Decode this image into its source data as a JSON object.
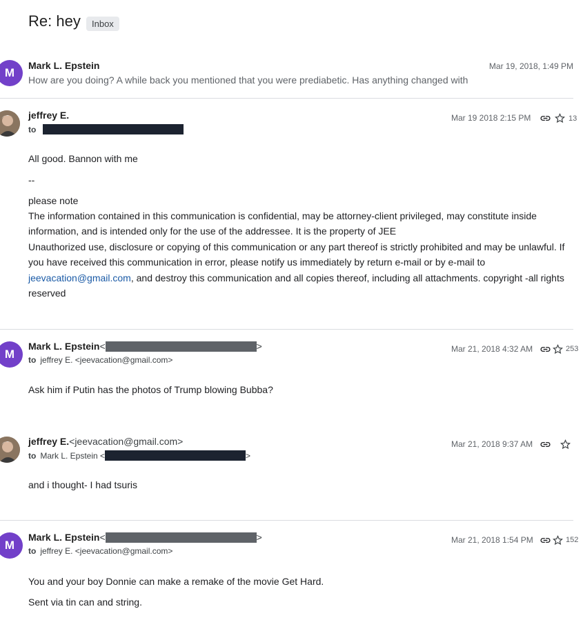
{
  "thread": {
    "subject": "Re: hey",
    "label": "Inbox"
  },
  "messages": [
    {
      "avatar_letter": "M",
      "sender": "Mark L. Epstein",
      "date": "Mar 19, 2018, 1:49 PM",
      "snippet": "How are you doing? A while back you mentioned that you were prediabetic. Has anything changed with"
    },
    {
      "sender": "jeffrey E.",
      "to_label": "to",
      "date": "Mar 19 2018 2:15 PM",
      "count": "13",
      "body_line1": "All good. Bannon with me",
      "sig_sep": "--",
      "sig_note": "please note",
      "sig_p1": "The information contained in this communication is confidential, may be attorney-client privileged, may constitute inside information, and is intended only for the use of the addressee. It is the property of JEE",
      "sig_p2a": "Unauthorized use, disclosure or copying of this communication or any part thereof is strictly prohibited and may be unlawful. If you have received this communication in error, please notify us immediately by return e-mail or by e-mail to",
      "sig_link": "jeevacation@gmail.com",
      "sig_p2b": ", and destroy this communication and all copies thereof, including all attachments. copyright -all rights reserved"
    },
    {
      "avatar_letter": "M",
      "sender": "Mark L. Epstein",
      "sender_open": "<",
      "sender_close": ">",
      "to_label": "to",
      "to_value": "jeffrey E. <jeevacation@gmail.com>",
      "date": "Mar 21, 2018 4:32 AM",
      "count": "253",
      "body": "Ask him if Putin has the photos of Trump blowing Bubba?"
    },
    {
      "sender": "jeffrey E.",
      "sender_addr": "<jeevacation@gmail.com>",
      "to_label": "to",
      "to_value": "Mark L. Epstein <",
      "to_close": ">",
      "date": "Mar 21, 2018 9:37 AM",
      "body": "and i thought- I had tsuris"
    },
    {
      "avatar_letter": "M",
      "sender": "Mark L. Epstein",
      "sender_open": "<",
      "sender_close": ">",
      "to_label": "to",
      "to_value": "jeffrey E. <jeevacation@gmail.com>",
      "date": "Mar 21, 2018 1:54 PM",
      "count": "152",
      "body1": "You and your boy Donnie can make a remake of the movie Get Hard.",
      "body2": "Sent via tin can and string."
    }
  ],
  "icons": {
    "link": "link-icon",
    "star": "star-icon"
  },
  "colors": {
    "avatar": "#7240c9",
    "link": "#1a5aa6",
    "redaction_dark": "#1c2330",
    "redaction_gray": "#5f6368"
  }
}
